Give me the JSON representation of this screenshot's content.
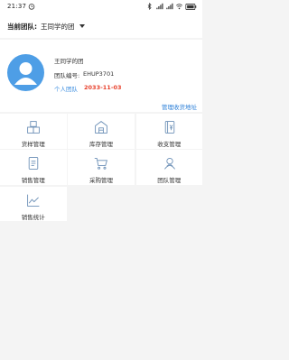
{
  "status_bar": {
    "time": "21:37"
  },
  "header": {
    "label": "当前团队:",
    "team_name": "王同学的团"
  },
  "profile": {
    "name": "王同学的团",
    "code_label": "团队编号:",
    "code_value": "EHUP3701",
    "type": "个人团队",
    "expiry": "2033-11-03",
    "address_link": "管理收货地址"
  },
  "menu": {
    "items": [
      {
        "label": "货样管理",
        "icon": "cubes-icon"
      },
      {
        "label": "库存管理",
        "icon": "warehouse-icon"
      },
      {
        "label": "收支管理",
        "icon": "ledger-icon"
      },
      {
        "label": "销售管理",
        "icon": "document-icon"
      },
      {
        "label": "采购管理",
        "icon": "cart-icon"
      },
      {
        "label": "团队管理",
        "icon": "team-icon"
      },
      {
        "label": "销售统计",
        "icon": "line-chart-icon"
      }
    ]
  },
  "colors": {
    "accent": "#3b8de0",
    "expiry": "#e8412c",
    "avatar": "#4e9ee6",
    "link": "#2b7fd8"
  }
}
